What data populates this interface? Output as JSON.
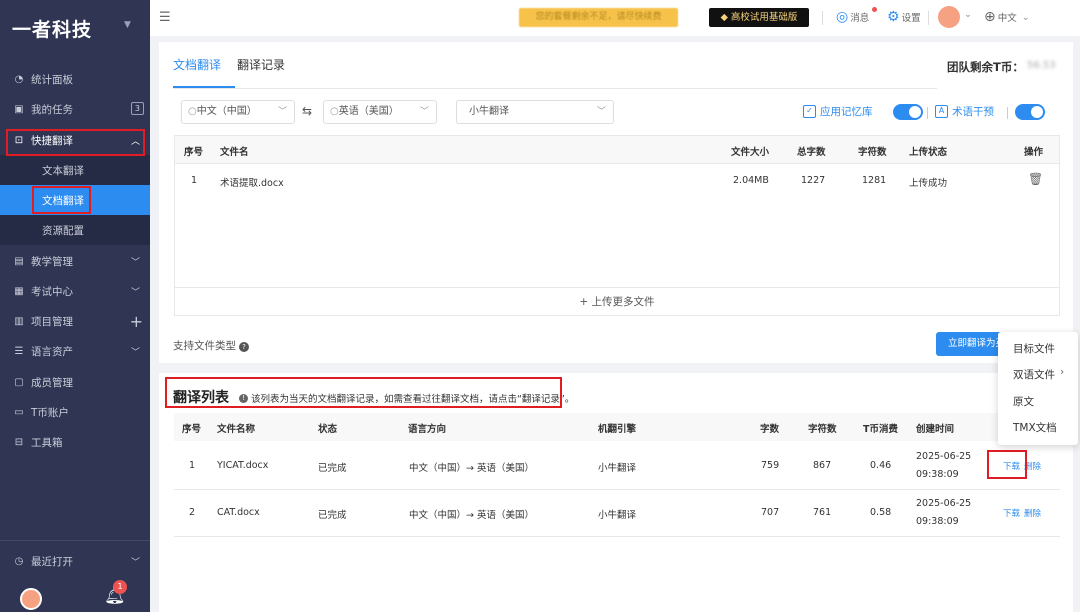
{
  "brand": {
    "name": "一者科技"
  },
  "sidebar": {
    "items": [
      {
        "label": "统计面板"
      },
      {
        "label": "我的任务",
        "badge": "3"
      },
      {
        "label": "快捷翻译"
      },
      {
        "label": "教学管理"
      },
      {
        "label": "考试中心"
      },
      {
        "label": "项目管理"
      },
      {
        "label": "语言资产"
      },
      {
        "label": "成员管理"
      },
      {
        "label": "T币账户"
      },
      {
        "label": "工具箱"
      }
    ],
    "subitems": [
      {
        "label": "文本翻译"
      },
      {
        "label": "文档翻译"
      },
      {
        "label": "资源配置"
      }
    ],
    "recent": {
      "label": "最近打开"
    },
    "notifications_count": "1"
  },
  "header": {
    "notice": "您的套餐剩余不足，请尽快续费",
    "edition": "高校试用基础版",
    "messages": "消息",
    "settings": "设置",
    "language": "中文"
  },
  "doc": {
    "tabs": [
      {
        "label": "文档翻译"
      },
      {
        "label": "翻译记录"
      }
    ],
    "team_balance_label": "团队剩余T币：",
    "team_balance_value": "56.53",
    "source_lang": "中文（中国）",
    "target_lang": "英语（美国）",
    "engine": "小牛翻译",
    "use_memory": "应用记忆库",
    "term_intervention": "术语干预",
    "columns": [
      "序号",
      "文件名",
      "文件大小",
      "总字数",
      "字符数",
      "上传状态",
      "操作"
    ],
    "files": [
      {
        "index": "1",
        "name": "术语提取.docx",
        "size": "2.04MB",
        "words": "1227",
        "chars": "1281",
        "status": "上传成功"
      }
    ],
    "upload_more": "+ 上传更多文件",
    "supported_types": "支持文件类型",
    "translate_button": "立即翻译为英文"
  },
  "list": {
    "title": "翻译列表",
    "note": "该列表为当天的文档翻译记录，如需查看过往翻译文档，请点击“翻译记录”。",
    "columns": [
      "序号",
      "文件名称",
      "状态",
      "语言方向",
      "机翻引擎",
      "字数",
      "字符数",
      "T币消费",
      "创建时间"
    ],
    "rows": [
      {
        "index": "1",
        "name": "YICAT.docx",
        "status": "已完成",
        "direction": "中文（中国）→ 英语（美国）",
        "engine": "小牛翻译",
        "words": "759",
        "chars": "867",
        "cost": "0.46",
        "date": "2025-06-25",
        "time": "09:38:09",
        "download": "下载",
        "delete": "删除"
      },
      {
        "index": "2",
        "name": "CAT.docx",
        "status": "已完成",
        "direction": "中文（中国）→ 英语（美国）",
        "engine": "小牛翻译",
        "words": "707",
        "chars": "761",
        "cost": "0.58",
        "date": "2025-06-25",
        "time": "09:38:09",
        "download": "下载",
        "delete": "删除"
      }
    ]
  },
  "download_menu": [
    "目标文件",
    "双语文件",
    "原文",
    "TMX文档"
  ]
}
